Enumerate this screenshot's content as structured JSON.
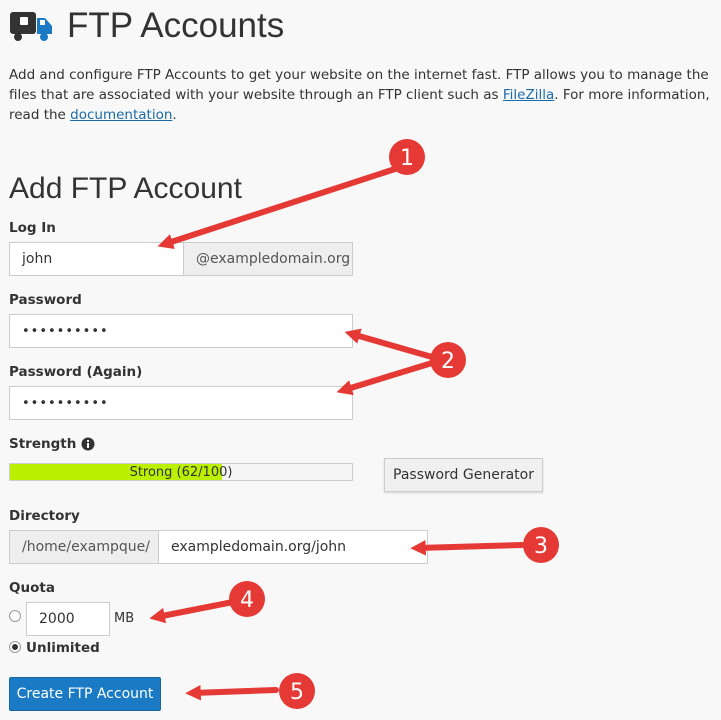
{
  "page": {
    "title": "FTP Accounts",
    "description_prefix": "Add and configure FTP Accounts to get your website on the internet fast. FTP allows you to manage the files that are associated with your website through an FTP client such as ",
    "filezilla_link": "FileZilla",
    "description_middle": ". For more information, read the ",
    "documentation_link": "documentation",
    "description_suffix": "."
  },
  "form": {
    "section_title": "Add FTP Account",
    "login_label": "Log In",
    "login_value": "john",
    "login_domain": "@exampledomain.org",
    "password_label": "Password",
    "password_value": "••••••••••",
    "password_again_label": "Password (Again)",
    "password_again_value": "••••••••••",
    "strength_label": "Strength",
    "strength_text": "Strong (62/100)",
    "strength_percent": 62,
    "password_generator_label": "Password Generator",
    "directory_label": "Directory",
    "directory_prefix": "/home/exampque/",
    "directory_value": "exampledomain.org/john",
    "quota_label": "Quota",
    "quota_value": "2000",
    "quota_unit": "MB",
    "unlimited_label": "Unlimited",
    "quota_selected": "Unlimited",
    "create_button_label": "Create FTP Account"
  },
  "annotations": {
    "badges": [
      "1",
      "2",
      "3",
      "4",
      "5"
    ],
    "arrow_color": "#e53935"
  },
  "colors": {
    "accent": "#1a7bc4",
    "strength_fill": "#bbf000",
    "link": "#1a6aa8"
  }
}
